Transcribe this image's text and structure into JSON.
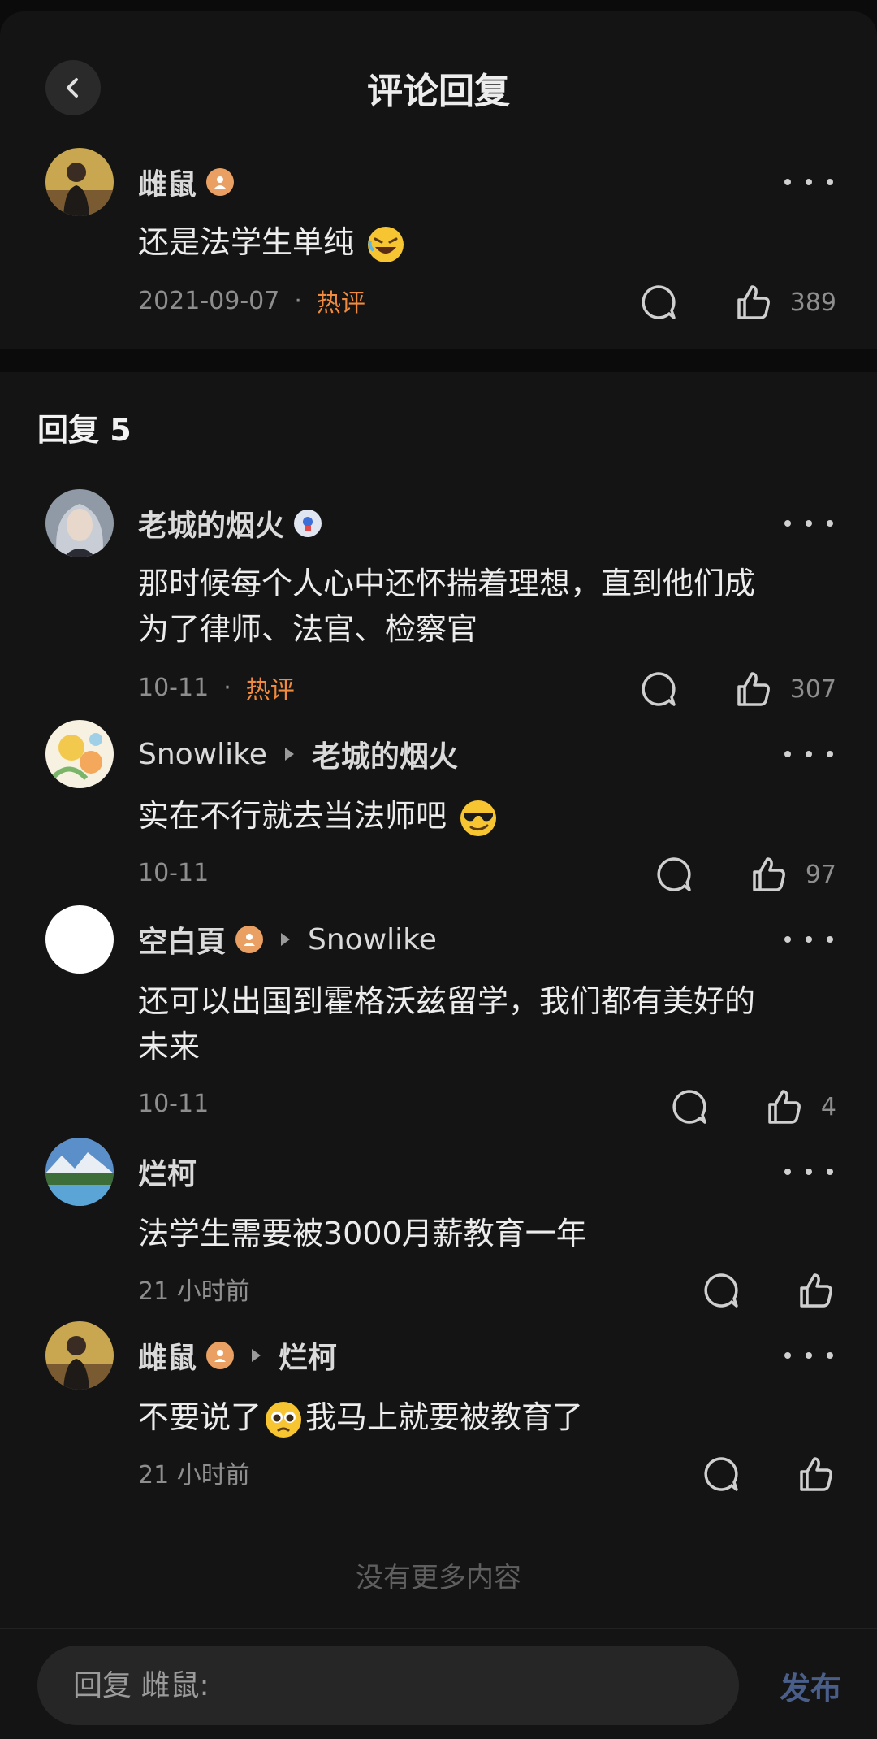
{
  "header": {
    "title": "评论回复"
  },
  "top_comment": {
    "author": "雌鼠",
    "content": "还是法学生单纯",
    "date": "2021-09-07",
    "dot": "·",
    "tag": "热评",
    "likes": "389"
  },
  "replies_header": "回复 5",
  "replies": [
    {
      "author": "老城的烟火",
      "content_line1": "那时候每个人心中还怀揣着理想，直到他们成",
      "content_line2": "为了律师、法官、检察官",
      "date": "10-11",
      "dot": "·",
      "tag": "热评",
      "likes": "307"
    },
    {
      "author": "Snowlike",
      "reply_to": "老城的烟火",
      "content": "实在不行就去当法师吧",
      "date": "10-11",
      "likes": "97"
    },
    {
      "author": "空白頁",
      "reply_to": "Snowlike",
      "content_line1": "还可以出国到霍格沃兹留学，我们都有美好的",
      "content_line2": "未来",
      "date": "10-11",
      "likes": "4"
    },
    {
      "author": "烂柯",
      "content": "法学生需要被3000月薪教育一年",
      "date": "21 小时前"
    },
    {
      "author": "雌鼠",
      "reply_to": "烂柯",
      "content_a": "不要说了",
      "content_b": "我马上就要被教育了",
      "date": "21 小时前"
    }
  ],
  "footer": {
    "no_more": "没有更多内容",
    "placeholder": "回复 雌鼠:",
    "publish": "发布"
  },
  "colors": {
    "background": "#141414",
    "hot_tag": "#f08a3e",
    "publish": "#4a5e8a"
  }
}
